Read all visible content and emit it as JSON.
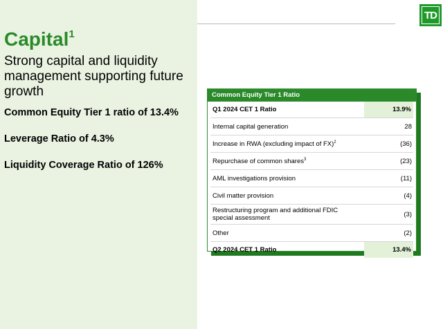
{
  "logo": {
    "text": "TD"
  },
  "title": {
    "text": "Capital",
    "superscript": "1"
  },
  "subtitle": "Strong capital and liquidity management supporting future growth",
  "metrics": [
    "Common Equity Tier 1 ratio of 13.4%",
    "Leverage Ratio of 4.3%",
    "Liquidity Coverage Ratio of 126%"
  ],
  "table": {
    "header": "Common Equity Tier 1 Ratio",
    "rows": [
      {
        "label": "Q1 2024 CET 1 Ratio",
        "value": "13.9%"
      },
      {
        "label": "Internal capital generation",
        "value": "28"
      },
      {
        "label": "Increase in RWA (excluding impact of FX)",
        "sup": "2",
        "value": "(36)"
      },
      {
        "label": "Repurchase of common shares",
        "sup": "3",
        "value": "(23)"
      },
      {
        "label": "AML investigations provision",
        "value": "(11)"
      },
      {
        "label": "Civil matter provision",
        "value": "(4)"
      },
      {
        "label": "Restructuring program and additional FDIC special assessment",
        "value": "(3)"
      },
      {
        "label": "Other",
        "value": "(2)"
      },
      {
        "label": "Q2 2024 CET 1 Ratio",
        "value": "13.4%"
      }
    ]
  },
  "colors": {
    "brand_green": "#2a8a2a",
    "panel_bg": "#eaf3e2",
    "highlight_cell": "#e3f1d8"
  }
}
